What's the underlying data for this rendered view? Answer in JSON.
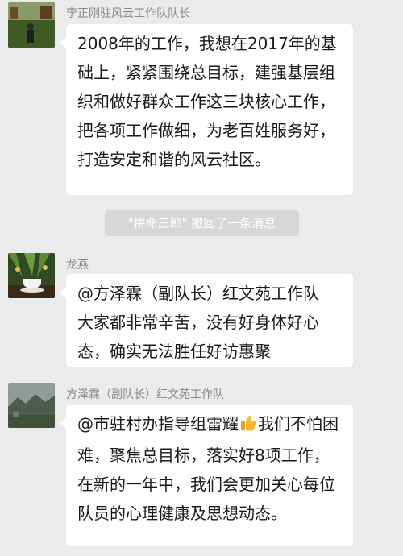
{
  "messages": [
    {
      "sender": "李正刚驻风云工作队队长",
      "avatar": "avatar-photo-man-outdoors",
      "text": "2008年的工作，我想在2017年的基础上，紧紧围绕总目标，建强基层组织和做好群众工作这三块核心工作，把各项工作做细，为老百姓服务好，打造安定和谐的风云社区。"
    },
    {
      "sender": "龙燕",
      "avatar": "avatar-photo-teacup-flowers",
      "text": "@方泽霖（副队长）红文苑工作队  大家都非常辛苦，没有好身体好心态，确实无法胜任好访惠聚"
    },
    {
      "sender": "方泽霖（副队长）红文苑工作队",
      "avatar": "avatar-photo-misty-landscape",
      "text_before_emoji": "@市驻村办指导组雷耀",
      "emoji": "thumbs-up-icon",
      "text_after_emoji": "我们不怕困难，聚焦总目标，落实好8项工作，在新的一年中，我们会更加关心每位队员的心理健康及思想动态。"
    }
  ],
  "system_notice": "\"拼命三郎\" 撤回了一条消息",
  "colors": {
    "background": "#ebebeb",
    "bubble": "#ffffff",
    "sender_name": "#8a8a8a",
    "system_notice_bg": "#d7d7d7"
  }
}
